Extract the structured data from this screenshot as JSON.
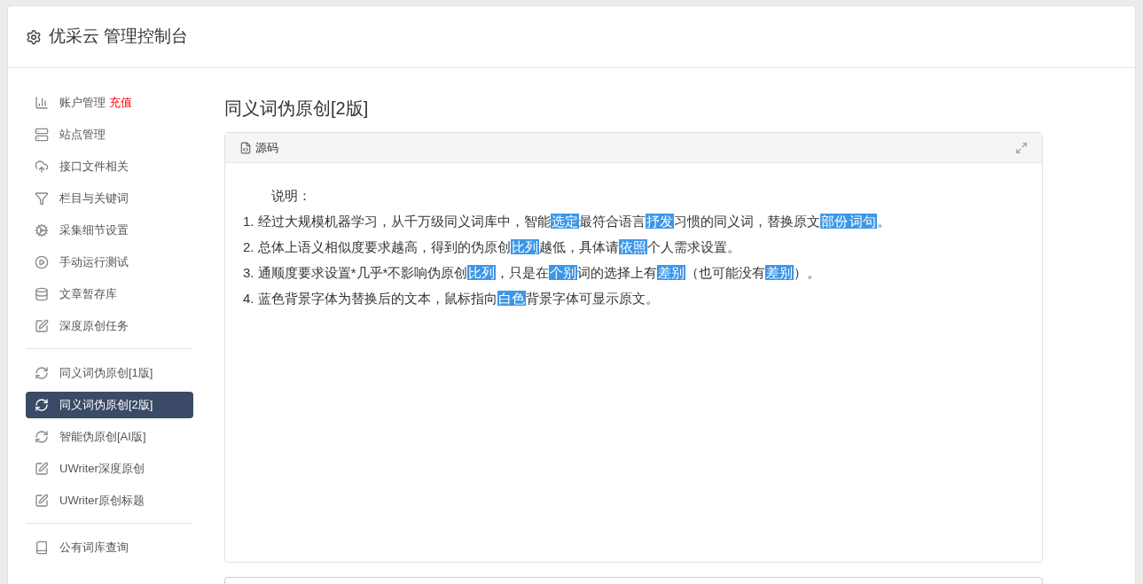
{
  "header": {
    "title": "优采云 管理控制台"
  },
  "sidebar": {
    "groups": [
      {
        "items": [
          {
            "label": "账户管理",
            "extra": "充值",
            "selected": false
          },
          {
            "label": "站点管理",
            "selected": false
          },
          {
            "label": "接口文件相关",
            "selected": false
          },
          {
            "label": "栏目与关键词",
            "selected": false
          },
          {
            "label": "采集细节设置",
            "selected": false
          },
          {
            "label": "手动运行测试",
            "selected": false
          },
          {
            "label": "文章暂存库",
            "selected": false
          },
          {
            "label": "深度原创任务",
            "selected": false
          }
        ]
      },
      {
        "items": [
          {
            "label": "同义词伪原创[1版]",
            "selected": false
          },
          {
            "label": "同义词伪原创[2版]",
            "selected": true
          },
          {
            "label": "智能伪原创[AI版]",
            "selected": false
          },
          {
            "label": "UWriter深度原创",
            "selected": false
          },
          {
            "label": "UWriter原创标题",
            "selected": false
          }
        ]
      },
      {
        "items": [
          {
            "label": "公有词库查询",
            "selected": false
          }
        ]
      }
    ]
  },
  "main": {
    "title": "同义词伪原创[2版]",
    "panel": {
      "tab": "源码",
      "heading": "说明：",
      "lines": [
        [
          {
            "text": "1. 经过大规模机器学习，从千万级同义词库中，智能",
            "highlighted": false
          },
          {
            "text": "选定",
            "highlighted": true
          },
          {
            "text": "最符合语言",
            "highlighted": false
          },
          {
            "text": "抒发",
            "highlighted": true
          },
          {
            "text": "习惯的同义词，替换原文",
            "highlighted": false
          },
          {
            "text": "部份",
            "highlighted": true
          },
          {
            "text": "词句",
            "highlighted": true
          },
          {
            "text": "。",
            "highlighted": false
          }
        ],
        [
          {
            "text": "2. 总体上语义相似度要求越高，得到的伪原创",
            "highlighted": false
          },
          {
            "text": "比列",
            "highlighted": true
          },
          {
            "text": "越低，具体请",
            "highlighted": false
          },
          {
            "text": "依照",
            "highlighted": true
          },
          {
            "text": "个人需求设置。",
            "highlighted": false
          }
        ],
        [
          {
            "text": "3. 通顺度要求设置*几乎*不影响伪原创",
            "highlighted": false
          },
          {
            "text": "比列",
            "highlighted": true
          },
          {
            "text": "，只是在",
            "highlighted": false
          },
          {
            "text": "个别",
            "highlighted": true
          },
          {
            "text": "词的选择上有",
            "highlighted": false
          },
          {
            "text": "差别",
            "highlighted": true
          },
          {
            "text": "（也可能没有",
            "highlighted": false
          },
          {
            "text": "差别",
            "highlighted": true
          },
          {
            "text": "）。",
            "highlighted": false
          }
        ],
        [
          {
            "text": "4. 蓝色背景字体为替换后的文本，鼠标指向",
            "highlighted": false
          },
          {
            "text": "白色",
            "highlighted": true
          },
          {
            "text": "背景字体可显示原文。",
            "highlighted": false
          }
        ]
      ]
    }
  }
}
